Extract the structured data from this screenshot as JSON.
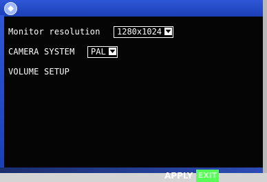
{
  "screen": {
    "monitor_resolution_label": "Monitor resolution",
    "monitor_resolution_value": "1280x1024",
    "camera_system_label": "CAMERA SYSTEM",
    "camera_system_value": "PAL",
    "volume_setup_label": "VOLUME SETUP",
    "apply_label": "APPLY",
    "exit_label": "EXIT"
  },
  "colors": {
    "title_bar": "#2f57d7",
    "panel_bg": "#050505",
    "text": "#ffffff",
    "exit_bg": "#55ff55"
  },
  "icons": [
    "menu-icon",
    "dropdown-arrow-icon"
  ]
}
